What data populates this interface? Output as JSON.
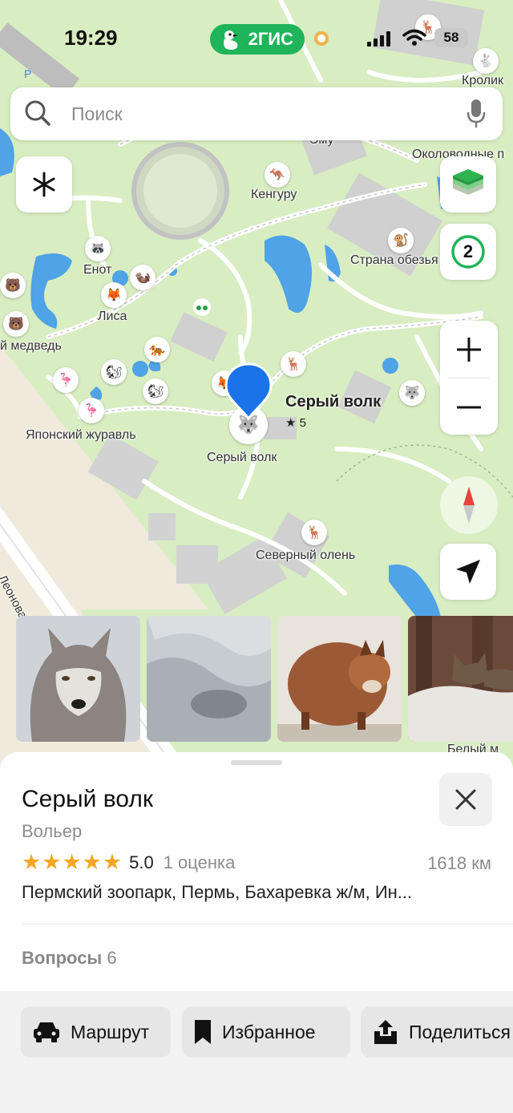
{
  "status_bar": {
    "time": "19:29",
    "brand": "2ГИС",
    "battery": "58"
  },
  "search": {
    "placeholder": "Поиск"
  },
  "map": {
    "labels": {
      "krolik": "Кролик",
      "emu": "Эму",
      "okolovodnye": "Околоводные п",
      "kenguru": "Кенгуру",
      "strana": "Страна обезья",
      "enot": "Енот",
      "lisa": "Лиса",
      "medved": "й медведь",
      "zhuravl": "Японский журавль",
      "volk": "Серый волк",
      "olen": "Северный олень",
      "street": "Леонова",
      "belyi": "Белый м"
    },
    "selected": {
      "title": "Серый волк",
      "rating": "★ 5"
    },
    "layers_count": "2"
  },
  "place": {
    "title": "Серый волк",
    "type": "Вольер",
    "rating_value": "5.0",
    "rating_count": "1 оценка",
    "stars": 5,
    "distance": "1618 км",
    "address": "Пермский зоопарк, Пермь, Бахаревка ж/м, Ин...",
    "questions_label": "Вопросы",
    "questions_count": "6"
  },
  "actions": {
    "route": "Маршрут",
    "favorites": "Избранное",
    "share": "Поделиться"
  },
  "colors": {
    "accent_green": "#1fb45a",
    "pin_blue": "#1a73e8",
    "star": "#f5a623"
  }
}
